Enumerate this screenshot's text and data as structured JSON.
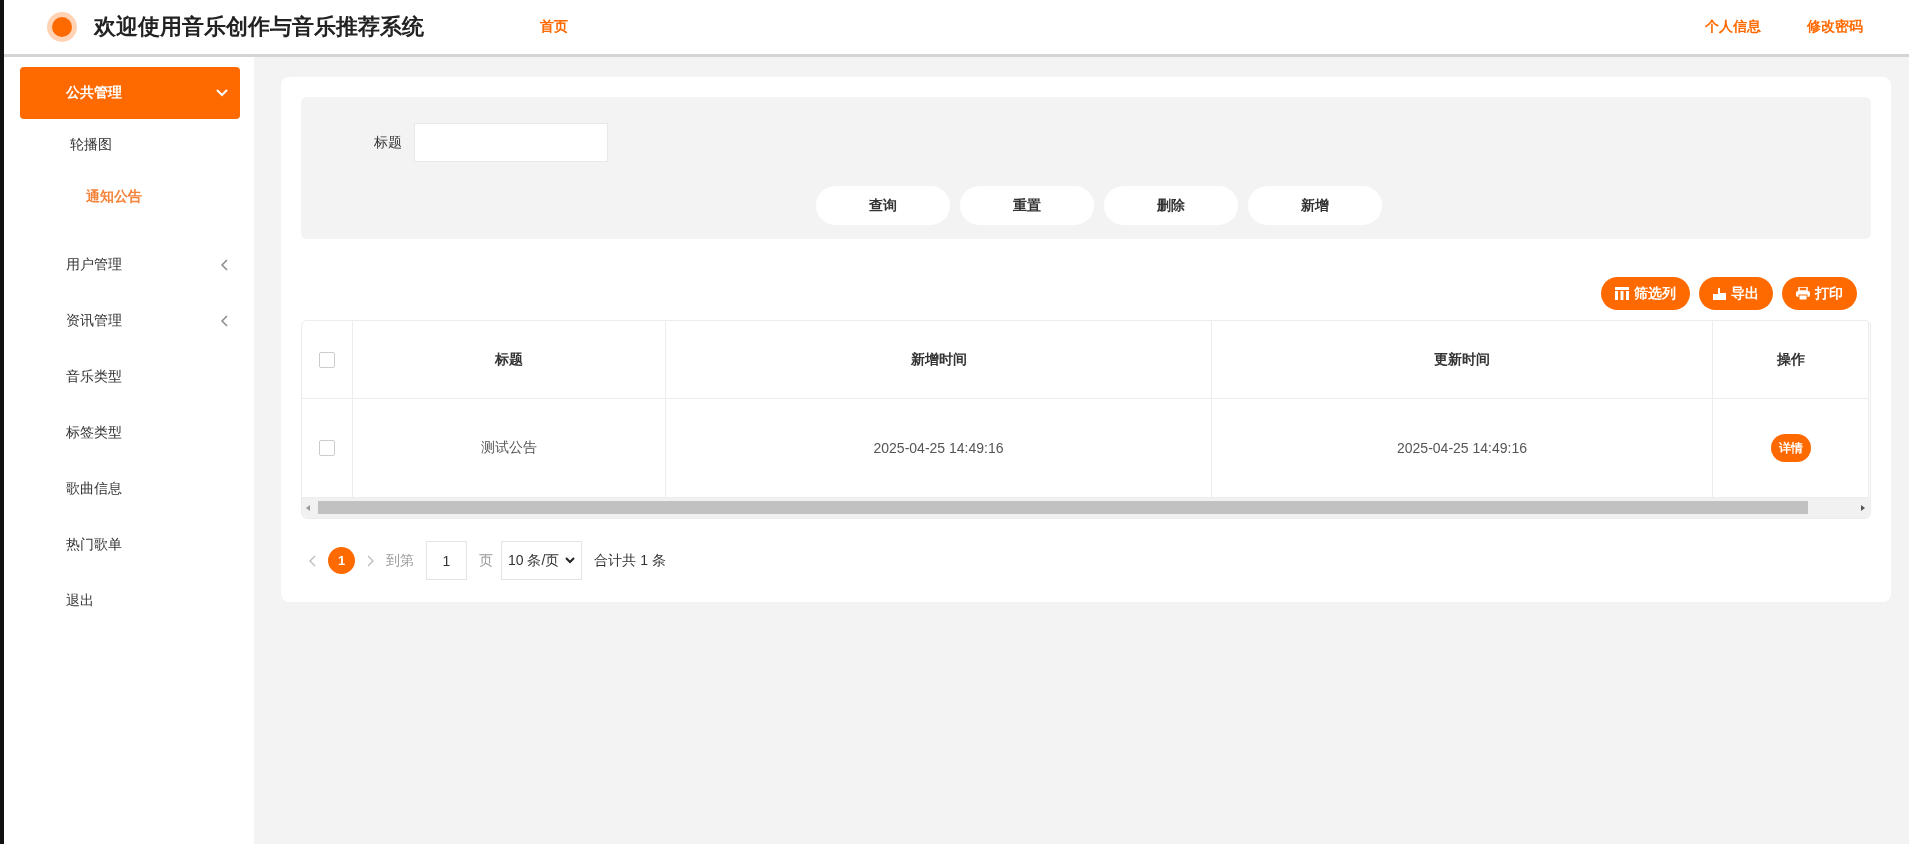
{
  "header": {
    "title": "欢迎使用音乐创作与音乐推荐系统",
    "nav": [
      {
        "label": "首页",
        "selected": true
      }
    ],
    "user_links": [
      "个人信息",
      "修改密码"
    ]
  },
  "sidebar": {
    "items": [
      {
        "label": "公共管理",
        "kind": "group",
        "expanded": true,
        "selected": true,
        "children": [
          {
            "label": "轮播图",
            "selected": false
          },
          {
            "label": "通知公告",
            "selected": true
          }
        ]
      },
      {
        "label": "用户管理",
        "kind": "group",
        "expanded": false,
        "selected": false
      },
      {
        "label": "资讯管理",
        "kind": "group",
        "expanded": false,
        "selected": false
      },
      {
        "label": "音乐类型",
        "kind": "link",
        "selected": false
      },
      {
        "label": "标签类型",
        "kind": "link",
        "selected": false
      },
      {
        "label": "歌曲信息",
        "kind": "link",
        "selected": false
      },
      {
        "label": "热门歌单",
        "kind": "link",
        "selected": false
      },
      {
        "label": "退出",
        "kind": "link",
        "selected": false
      }
    ]
  },
  "search": {
    "fields": [
      {
        "label": "标题"
      }
    ],
    "buttons": [
      "查询",
      "重置",
      "删除",
      "新增"
    ]
  },
  "toolbar": [
    "筛选列",
    "导出",
    "打印"
  ],
  "table": {
    "all_selected": false,
    "columns": [
      "标题",
      "新增时间",
      "更新时间",
      "操作"
    ],
    "rows": [
      {
        "selected": false,
        "cells": [
          "测试公告",
          "2025-04-25 14:49:16",
          "2025-04-25 14:49:16"
        ],
        "actions": [
          "详情"
        ]
      }
    ]
  },
  "pagination": {
    "pages": [
      {
        "label": "1",
        "selected": true
      }
    ],
    "goto_label": "到第",
    "goto_value": "1",
    "goto_suffix": "页",
    "page_size": "10 条/页",
    "total": "合计共 1 条"
  }
}
